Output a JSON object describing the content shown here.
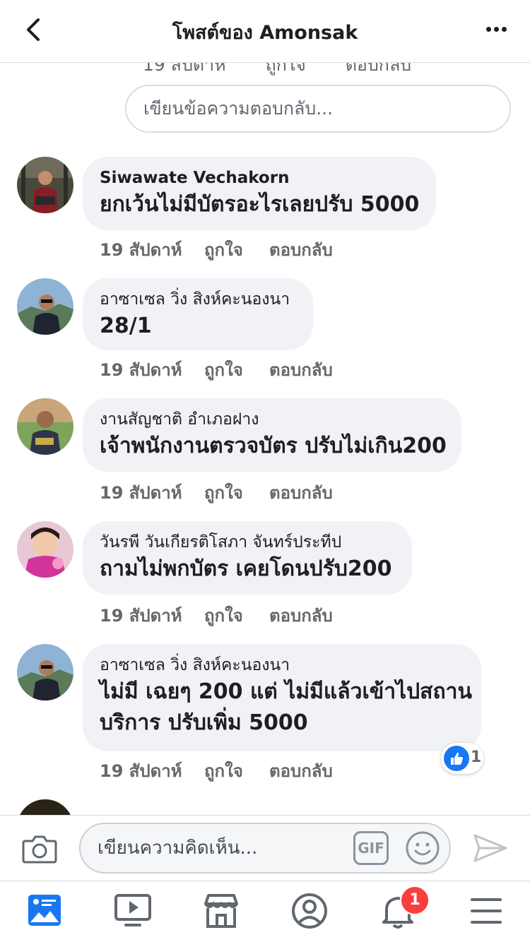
{
  "header": {
    "title": "โพสต์ของ Amonsak",
    "back_icon": "chevron-left-icon",
    "more_icon": "more-horizontal-icon"
  },
  "prev_actions": {
    "time": "19 สัปดาห์",
    "like": "ถูกใจ",
    "reply": "ตอบกลับ"
  },
  "reply_box": {
    "placeholder": "เขียนข้อความตอบกลับ..."
  },
  "comments": [
    {
      "author": "Siwawate Vechakorn",
      "lines": [
        "ยกเว้นไม่มีบัตรอะไรเลยปรับ 5000"
      ],
      "time": "19 สัปดาห์",
      "like": "ถูกใจ",
      "reply": "ตอบกลับ"
    },
    {
      "author": "อาซาเซล วิ่ง สิงห์คะนองนา",
      "lines": [
        "28/1"
      ],
      "time": "19 สัปดาห์",
      "like": "ถูกใจ",
      "reply": "ตอบกลับ"
    },
    {
      "author": "งานสัญชาติ อำเภอฝาง",
      "lines": [
        "เจ้าพนักงานตรวจบัตร ปรับไม่เกิน200"
      ],
      "time": "19 สัปดาห์",
      "like": "ถูกใจ",
      "reply": "ตอบกลับ"
    },
    {
      "author": "วันรพี วันเกียรติโสภา จันทร์ประทีป",
      "lines": [
        "ถามไม่พกบัตร เคยโดนปรับ200"
      ],
      "time": "19 สัปดาห์",
      "like": "ถูกใจ",
      "reply": "ตอบกลับ"
    },
    {
      "author": "อาซาเซล วิ่ง สิงห์คะนองนา",
      "lines": [
        "ไม่มี เฉยๆ 200 แต่ ไม่มีแล้วเข้าไปสถาน",
        "บริการ ปรับเพิ่ม 5000"
      ],
      "time": "19 สัปดาห์",
      "like": "ถูกใจ",
      "reply": "ตอบกลับ",
      "reaction_count": "1"
    }
  ],
  "composer": {
    "placeholder": "เขียนความคิดเห็น...",
    "gif_label": "GIF",
    "camera_icon": "camera-icon",
    "emoji_icon": "smile-icon",
    "send_icon": "send-icon"
  },
  "tabbar": {
    "icons": [
      "news-feed-icon",
      "watch-icon",
      "marketplace-icon",
      "profile-icon",
      "notifications-icon",
      "menu-icon"
    ],
    "active": "news-feed-icon",
    "notification_badge": "1",
    "active_color": "#1877f2",
    "inactive_color": "#606770"
  }
}
